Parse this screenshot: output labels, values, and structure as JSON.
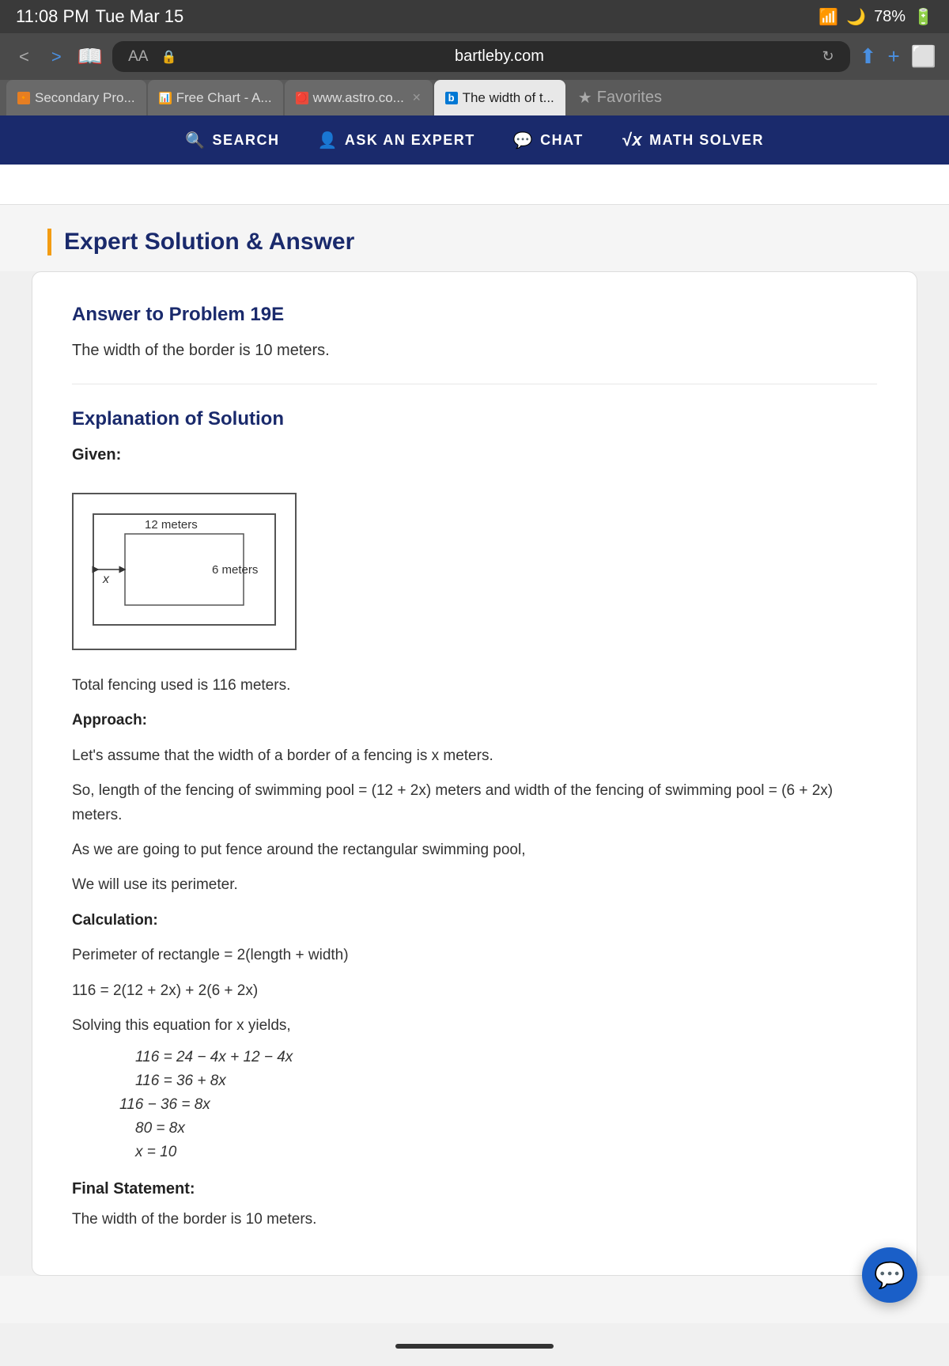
{
  "status_bar": {
    "time": "11:08 PM",
    "date": "Tue Mar 15",
    "wifi": "📶",
    "moon": "🌙",
    "battery": "78%"
  },
  "browser": {
    "url_aa": "AA",
    "url": "bartleby.com",
    "tabs": [
      {
        "id": "secondary-pro",
        "label": "Secondary Pro...",
        "icon": "🔸",
        "active": false,
        "closable": false
      },
      {
        "id": "free-chart",
        "label": "Free Chart - A...",
        "icon": "📊",
        "active": false,
        "closable": false
      },
      {
        "id": "astro",
        "label": "www.astro.co...",
        "icon": "🔴",
        "active": false,
        "closable": true
      },
      {
        "id": "bing",
        "label": "The width of t...",
        "icon": "b",
        "active": true,
        "closable": false
      }
    ],
    "favorites_label": "Favorites"
  },
  "navbar": {
    "items": [
      {
        "id": "search",
        "icon": "🔍",
        "label": "SEARCH"
      },
      {
        "id": "ask-expert",
        "icon": "👤",
        "label": "ASK AN EXPERT"
      },
      {
        "id": "chat",
        "icon": "💬",
        "label": "CHAT"
      },
      {
        "id": "math-solver",
        "icon": "√x",
        "label": "MATH SOLVER"
      }
    ]
  },
  "expert_solution": {
    "section_title": "Expert Solution & Answer",
    "answer_card": {
      "problem_title": "Answer to Problem 19E",
      "answer_text": "The width of the border is 10 meters.",
      "explanation_title": "Explanation of Solution",
      "given_label": "Given:",
      "diagram": {
        "outer_width": 220,
        "outer_height": 140,
        "inner_label_top": "12 meters",
        "inner_label_right": "6 meters",
        "arrow_label": "x"
      },
      "fencing_text": "Total fencing used is 116 meters.",
      "approach_label": "Approach:",
      "approach_text": "Let's assume that the width of a border of a fencing is x meters.",
      "approach_text2": "So, length of the fencing of swimming pool = (12 + 2x) meters and width of the fencing of swimming pool = (6 + 2x) meters.",
      "approach_text3": "As we are going to put fence around the rectangular swimming pool,",
      "approach_text4": "We will use its perimeter.",
      "calculation_label": "Calculation:",
      "calc_line1": "Perimeter of rectangle = 2(length + width)",
      "calc_line2": "116 = 2(12 + 2x) + 2(6 + 2x)",
      "calc_line3": "Solving this equation for x yields,",
      "calc_line4": "116 = 24 − 4x + 12 − 4x",
      "calc_line5": "116 = 36 + 8x",
      "calc_line6": "116 − 36 = 8x",
      "calc_line7": "80 = 8x",
      "calc_line8": "x = 10",
      "final_label": "Final Statement:",
      "final_text": "The width of the border is 10 meters."
    }
  },
  "chat_button_icon": "💬",
  "home_indicator": true
}
